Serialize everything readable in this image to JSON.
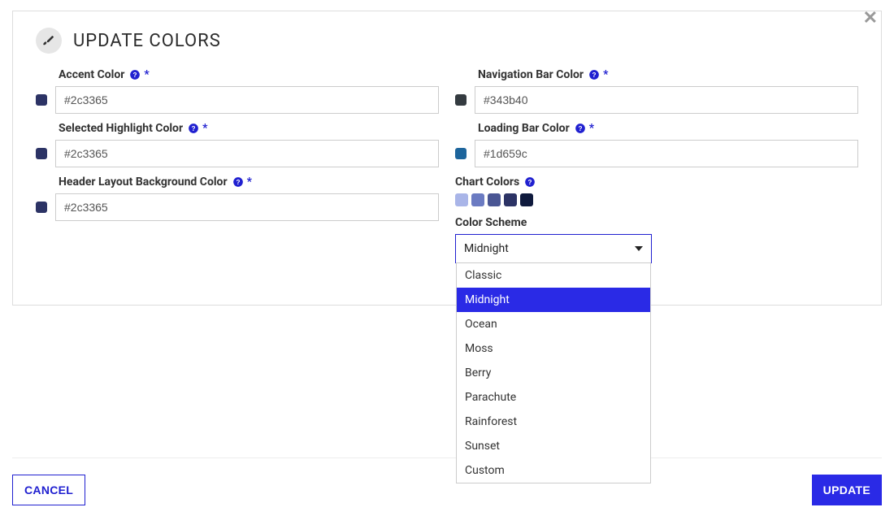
{
  "header": {
    "title": "UPDATE COLORS"
  },
  "fields": {
    "accent": {
      "label": "Accent Color",
      "required": true,
      "value": "#2c3365",
      "swatch": "#2c3365"
    },
    "selected_highlight": {
      "label": "Selected Highlight Color",
      "required": true,
      "value": "#2c3365",
      "swatch": "#2c3365"
    },
    "header_layout_bg": {
      "label": "Header Layout Background Color",
      "required": true,
      "value": "#2c3365",
      "swatch": "#2c3365"
    },
    "navbar": {
      "label": "Navigation Bar Color",
      "required": true,
      "value": "#343b40",
      "swatch": "#343b40"
    },
    "loading_bar": {
      "label": "Loading Bar Color",
      "required": true,
      "value": "#1d659c",
      "swatch": "#1d659c"
    }
  },
  "chart_colors": {
    "label": "Chart Colors",
    "swatches": [
      "#a9b5e8",
      "#6b7bc2",
      "#4a5694",
      "#2c3365",
      "#0f1a3d"
    ]
  },
  "color_scheme": {
    "label": "Color Scheme",
    "selected": "Midnight",
    "options": [
      "Classic",
      "Midnight",
      "Ocean",
      "Moss",
      "Berry",
      "Parachute",
      "Rainforest",
      "Sunset",
      "Custom"
    ]
  },
  "footer": {
    "cancel": "CANCEL",
    "update": "UPDATE"
  },
  "required_marker": "*"
}
